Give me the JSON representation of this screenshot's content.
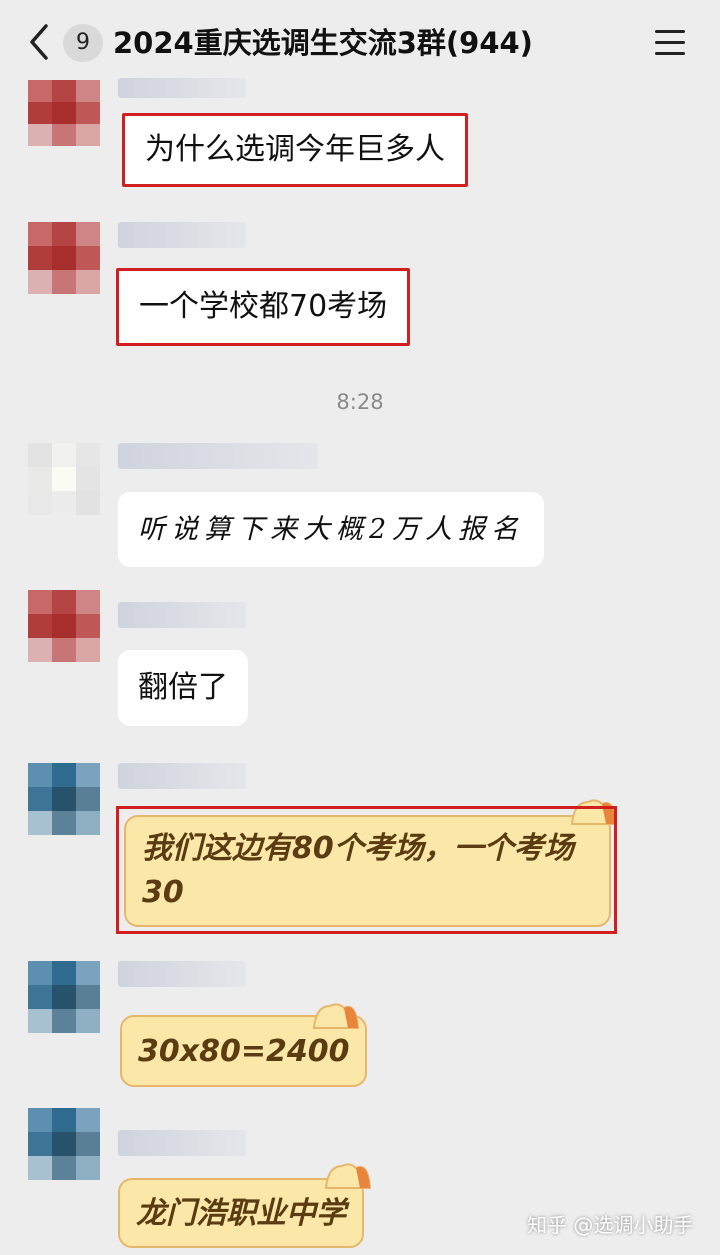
{
  "header": {
    "unread_count": "9",
    "title": "2024重庆选调生交流3群(944)"
  },
  "timestamp": "8:28",
  "messages": [
    {
      "text": "为什么选调今年巨多人"
    },
    {
      "text": "一个学校都70考场"
    },
    {
      "text": "听说算下来大概2万人报名"
    },
    {
      "text": "翻倍了"
    },
    {
      "text": "我们这边有80个考场，一个考场30"
    },
    {
      "text": "30x80=2400"
    },
    {
      "text": "龙门浩职业中学"
    }
  ],
  "watermark": "知乎 @选调小助手",
  "colors": {
    "background": "#ededed",
    "bubble": "#ffffff",
    "highlight": "#d11f1f",
    "sticker_fill": "#fbe7a8",
    "sticker_text": "#5a3b12"
  }
}
